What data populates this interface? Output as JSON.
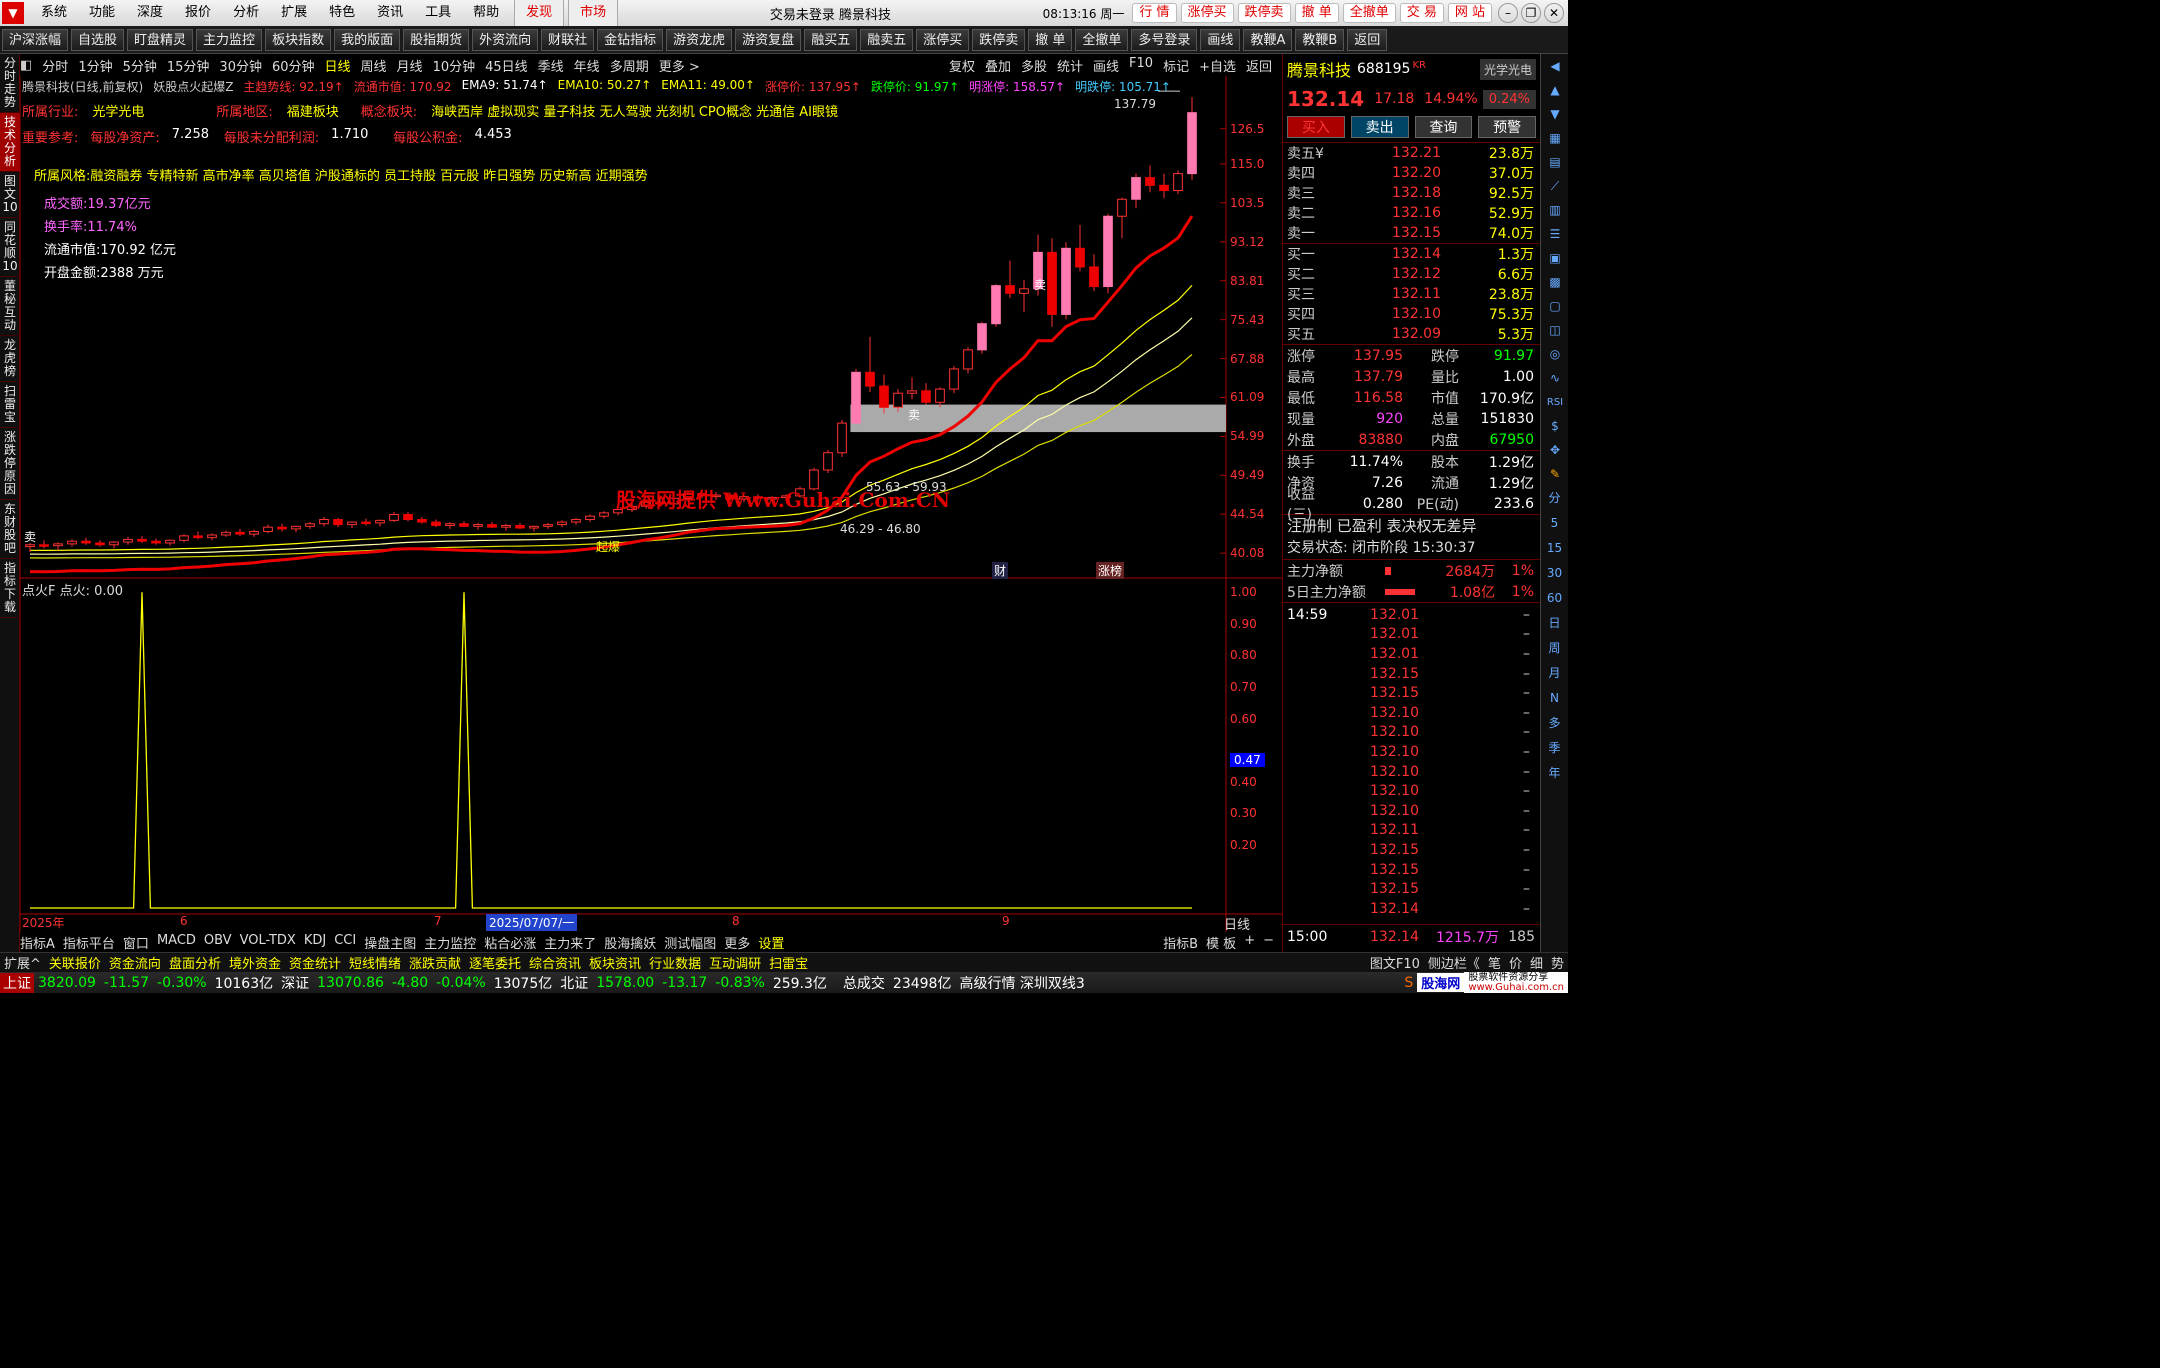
{
  "menu": {
    "items": [
      "系统",
      "功能",
      "深度",
      "报价",
      "分析",
      "扩展",
      "特色",
      "资讯",
      "工具",
      "帮助"
    ],
    "highlight": [
      "发现",
      "市场"
    ],
    "center_title": "交易未登录  腾景科技",
    "time": "08:13:16 周一",
    "right_buttons": [
      "行 情",
      "涨停买",
      "跌停卖",
      "撤 单",
      "全撤单",
      "交 易",
      "网 站"
    ]
  },
  "toolbar": [
    "沪深涨幅",
    "自选股",
    "盯盘精灵",
    "主力监控",
    "板块指数",
    "我的版面",
    "股指期货",
    "外资流向",
    "财联社",
    "金钻指标",
    "游资龙虎",
    "游资复盘",
    "融买五",
    "融卖五",
    "涨停买",
    "跌停卖",
    "撤 单",
    "全撤单",
    "多号登录",
    "画线",
    "教鞭A",
    "教鞭B",
    "返回"
  ],
  "left_tabs": [
    {
      "label": "分时走势",
      "active": false
    },
    {
      "label": "技术分析",
      "active": true
    },
    {
      "label": "图文10",
      "active": false
    },
    {
      "label": "同花顺10",
      "active": false
    },
    {
      "label": "董秘互动",
      "active": false
    },
    {
      "label": "龙虎榜",
      "active": false
    },
    {
      "label": "扫雷宝",
      "active": false
    },
    {
      "label": "涨跌停原因",
      "active": false
    },
    {
      "label": "东财股吧",
      "active": false
    },
    {
      "label": "指标下载",
      "active": false
    }
  ],
  "periods": [
    "分时",
    "1分钟",
    "5分钟",
    "15分钟",
    "30分钟",
    "60分钟",
    "日线",
    "周线",
    "月线",
    "10分钟",
    "45日线",
    "季线",
    "年线",
    "多周期",
    "更多 >"
  ],
  "period_active": "日线",
  "period_right": [
    "复权",
    "叠加",
    "多股",
    "统计",
    "画线",
    "F10",
    "标记",
    "+自选",
    "返回"
  ],
  "kinfo": {
    "name": "腾景科技(日线,前复权)",
    "formula": "妖股点火起爆Z",
    "main_line": "主趋势线: 92.19↑",
    "flow_mv": "流通市值: 170.92",
    "ema9": "EMA9: 51.74↑",
    "ema10": "EMA10: 50.27↑",
    "ema11": "EMA11: 49.00↑",
    "limit_up": "涨停价: 137.95↑",
    "limit_down": "跌停价: 91.97↑",
    "next_up": "明涨停: 158.57↑",
    "next_down": "明跌停: 105.71↑"
  },
  "industry": {
    "k1": "所属行业:",
    "v1": "光学光电",
    "k2": "所属地区:",
    "v2": "福建板块",
    "k3": "概念板块:",
    "v3": "海峡西岸 虚拟现实 量子科技 无人驾驶 光刻机 CPO概念 光通信 AI眼镜"
  },
  "important": {
    "k": "重要参考:",
    "a": "每股净资产:",
    "av": "7.258",
    "b": "每股未分配利润:",
    "bv": "1.710",
    "c": "每股公积金:",
    "cv": "4.453"
  },
  "style": "所属风格:融资融券 专精特新 高市净率 高贝塔值 沪股通标的 员工持股 百元股 昨日强势 历史新高 近期强势",
  "stats": [
    "成交额:19.37亿元",
    "换手率:11.74%",
    "流通市值:170.92 亿元",
    "开盘金额:2388 万元"
  ],
  "annotations": {
    "watermark": "股海网提供 Www.Guhai.Com.CN",
    "range1": "55.63 - 59.93",
    "range2": "46.29 - 46.80",
    "high_label": "137.79",
    "sell": "卖",
    "buy_label": "起爆",
    "cai": "财",
    "zhangbang": "涨榜"
  },
  "yaxis": [
    "126.5",
    "115.0",
    "103.5",
    "93.12",
    "83.81",
    "75.43",
    "67.88",
    "61.09",
    "54.99",
    "49.49",
    "44.54",
    "40.08"
  ],
  "ind_title": "点火F  点火: 0.00",
  "ind_yaxis": [
    "1.00",
    "0.90",
    "0.80",
    "0.70",
    "0.60",
    "0.47",
    "0.40",
    "0.30",
    "0.20"
  ],
  "date_axis": [
    "2025年",
    "6",
    "7",
    "2025/07/07/一",
    "8",
    "9"
  ],
  "date_axis_right": "日线",
  "bottom_tabs": [
    "指标A",
    "指标平台",
    "窗口",
    "MACD",
    "OBV",
    "VOL-TDX",
    "KDJ",
    "CCI",
    "操盘主图",
    "主力监控",
    "粘合必涨",
    "主力来了",
    "股海擒妖",
    "测试幅图",
    "更多",
    "设置"
  ],
  "bottom_right": [
    "指标B",
    "模 板",
    "+",
    "−"
  ],
  "infobar": [
    "扩展^",
    "关联报价",
    "资金流向",
    "盘面分析",
    "境外资金",
    "资金统计",
    "短线情绪",
    "涨跌贡献",
    "逐笔委托",
    "综合资讯",
    "板块资讯",
    "行业数据",
    "互动调研",
    "扫雷宝"
  ],
  "infobar_right": [
    "图文F10",
    "侧边栏《",
    "笔",
    "价",
    "细",
    "势"
  ],
  "status": {
    "sh_label": "上证",
    "sh": "3820.09",
    "sh_chg": "-11.57",
    "sh_pct": "-0.30%",
    "sh_amt": "10163亿",
    "sz_label": "深证",
    "sz": "13070.86",
    "sz_chg": "-4.80",
    "sz_pct": "-0.04%",
    "sz_amt": "13075亿",
    "bj_label": "北证",
    "bj": "1578.00",
    "bj_chg": "-13.17",
    "bj_pct": "-0.83%",
    "bj_amt": "259.3亿",
    "total_label": "总成交",
    "total": "23498亿",
    "market": "高级行情 深圳双线3",
    "brand": "股海网",
    "brand2": "股票软件资源分享",
    "url": "www.Guhai.com.cn"
  },
  "quote": {
    "name": "腾景科技",
    "code": "688195",
    "kr": "KR",
    "sector": "光学光电",
    "price": "132.14",
    "chg": "17.18",
    "pct": "14.94%",
    "amp": "0.24%",
    "buttons": [
      "买入",
      "卖出",
      "查询",
      "预警"
    ],
    "asks": [
      [
        "卖五¥",
        "132.21",
        "23.8万"
      ],
      [
        "卖四",
        "132.20",
        "37.0万"
      ],
      [
        "卖三",
        "132.18",
        "92.5万"
      ],
      [
        "卖二",
        "132.16",
        "52.9万"
      ],
      [
        "卖一",
        "132.15",
        "74.0万"
      ]
    ],
    "bids": [
      [
        "买一",
        "132.14",
        "1.3万"
      ],
      [
        "买二",
        "132.12",
        "6.6万"
      ],
      [
        "买三",
        "132.11",
        "23.8万"
      ],
      [
        "买四",
        "132.10",
        "75.3万"
      ],
      [
        "买五",
        "132.09",
        "5.3万"
      ]
    ],
    "stats1": [
      [
        "涨停",
        "137.95",
        "跌停",
        "91.97"
      ],
      [
        "最高",
        "137.79",
        "量比",
        "1.00"
      ],
      [
        "最低",
        "116.58",
        "市值",
        "170.9亿"
      ],
      [
        "现量",
        "920",
        "总量",
        "151830"
      ],
      [
        "外盘",
        "83880",
        "内盘",
        "67950"
      ]
    ],
    "stats2": [
      [
        "换手",
        "11.74%",
        "股本",
        "1.29亿"
      ],
      [
        "净资",
        "7.26",
        "流通",
        "1.29亿"
      ],
      [
        "收益(三)",
        "0.280",
        "PE(动)",
        "233.6"
      ]
    ],
    "reg": "注册制 已盈利 表决权无差异",
    "trade_state": "交易状态: 闭市阶段 15:30:37",
    "mainflow": [
      "主力净额",
      "2684万",
      "1%"
    ],
    "mainflow5": [
      "5日主力净额",
      "1.08亿",
      "1%"
    ],
    "ticks_time": "14:59",
    "ticks": [
      "132.01",
      "132.01",
      "132.01",
      "132.15",
      "132.15",
      "132.10",
      "132.10",
      "132.10",
      "132.10",
      "132.10",
      "132.10",
      "132.11",
      "132.15",
      "132.15",
      "132.15",
      "132.14"
    ],
    "tick_last_time": "15:00",
    "tick_last_price": "132.14",
    "tick_last_amt": "1215.7万",
    "tick_last_n": "185"
  },
  "right_strip": [
    "分",
    "5",
    "15",
    "30",
    "60",
    "日",
    "周",
    "月",
    "N",
    "多",
    "季",
    "年"
  ],
  "chart_data": {
    "type": "candlestick",
    "candles": [
      [
        40.8,
        41.2,
        40.2,
        41.0
      ],
      [
        41.0,
        41.5,
        40.6,
        40.9
      ],
      [
        40.9,
        41.3,
        40.4,
        41.1
      ],
      [
        41.1,
        41.6,
        40.8,
        41.4
      ],
      [
        41.4,
        41.8,
        41.0,
        41.2
      ],
      [
        41.2,
        41.5,
        40.8,
        41.0
      ],
      [
        41.0,
        41.4,
        40.6,
        41.3
      ],
      [
        41.3,
        41.9,
        41.0,
        41.6
      ],
      [
        41.6,
        42.0,
        41.2,
        41.4
      ],
      [
        41.4,
        41.7,
        41.0,
        41.2
      ],
      [
        41.2,
        41.6,
        40.9,
        41.5
      ],
      [
        41.5,
        42.2,
        41.3,
        42.0
      ],
      [
        42.0,
        42.5,
        41.6,
        41.8
      ],
      [
        41.8,
        42.3,
        41.5,
        42.1
      ],
      [
        42.1,
        42.6,
        41.9,
        42.4
      ],
      [
        42.4,
        42.8,
        42.0,
        42.2
      ],
      [
        42.2,
        42.7,
        41.9,
        42.5
      ],
      [
        42.5,
        43.3,
        42.3,
        43.0
      ],
      [
        43.0,
        43.4,
        42.5,
        42.8
      ],
      [
        42.8,
        43.2,
        42.4,
        43.1
      ],
      [
        43.1,
        43.6,
        42.8,
        43.4
      ],
      [
        43.4,
        44.2,
        43.1,
        43.9
      ],
      [
        43.9,
        44.1,
        43.0,
        43.3
      ],
      [
        43.3,
        43.7,
        42.9,
        43.6
      ],
      [
        43.6,
        44.0,
        43.2,
        43.5
      ],
      [
        43.5,
        43.9,
        43.1,
        43.8
      ],
      [
        43.8,
        44.8,
        43.6,
        44.5
      ],
      [
        44.5,
        44.8,
        43.7,
        43.9
      ],
      [
        43.9,
        44.2,
        43.4,
        43.6
      ],
      [
        43.6,
        43.9,
        43.0,
        43.2
      ],
      [
        43.2,
        43.6,
        42.8,
        43.4
      ],
      [
        43.4,
        43.7,
        43.0,
        43.1
      ],
      [
        43.1,
        43.5,
        42.7,
        43.3
      ],
      [
        43.3,
        43.6,
        42.9,
        43.0
      ],
      [
        43.0,
        43.4,
        42.6,
        43.2
      ],
      [
        43.2,
        43.5,
        42.8,
        42.9
      ],
      [
        42.9,
        43.2,
        42.5,
        43.1
      ],
      [
        43.1,
        43.5,
        42.8,
        43.3
      ],
      [
        43.3,
        43.8,
        43.0,
        43.6
      ],
      [
        43.6,
        44.1,
        43.3,
        43.9
      ],
      [
        43.9,
        44.5,
        43.6,
        44.3
      ],
      [
        44.3,
        44.9,
        44.0,
        44.7
      ],
      [
        44.7,
        45.4,
        44.4,
        45.1
      ],
      [
        45.1,
        45.8,
        44.8,
        45.5
      ],
      [
        45.5,
        46.3,
        45.2,
        46.0
      ],
      [
        46.0,
        46.6,
        45.6,
        45.8
      ],
      [
        45.8,
        46.8,
        45.5,
        46.5
      ],
      [
        46.5,
        47.4,
        46.2,
        47.1
      ],
      [
        47.1,
        47.6,
        46.5,
        46.8
      ],
      [
        46.8,
        47.3,
        46.3,
        46.9
      ],
      [
        46.9,
        47.2,
        46.1,
        46.4
      ],
      [
        46.4,
        46.9,
        46.0,
        46.7
      ],
      [
        46.7,
        47.0,
        46.2,
        46.5
      ],
      [
        46.5,
        46.8,
        46.0,
        46.6
      ],
      [
        46.6,
        47.0,
        46.2,
        46.8
      ],
      [
        46.8,
        48.0,
        46.6,
        47.7
      ],
      [
        47.7,
        50.5,
        47.5,
        50.2
      ],
      [
        50.2,
        53.0,
        49.8,
        52.6
      ],
      [
        52.6,
        57.5,
        52.0,
        57.0
      ],
      [
        57.0,
        66.0,
        56.8,
        65.4
      ],
      [
        65.4,
        72.0,
        62.0,
        63.0
      ],
      [
        63.0,
        65.0,
        58.5,
        59.5
      ],
      [
        59.5,
        62.5,
        58.8,
        61.8
      ],
      [
        61.8,
        64.5,
        60.8,
        62.2
      ],
      [
        62.2,
        63.5,
        59.9,
        60.3
      ],
      [
        60.3,
        62.8,
        59.5,
        62.5
      ],
      [
        62.5,
        66.5,
        61.8,
        66.0
      ],
      [
        66.0,
        70.0,
        65.2,
        69.5
      ],
      [
        69.5,
        75.0,
        68.8,
        74.6
      ],
      [
        74.6,
        83.0,
        74.0,
        82.7
      ],
      [
        82.7,
        88.5,
        80.0,
        81.0
      ],
      [
        81.0,
        84.0,
        77.0,
        82.0
      ],
      [
        82.0,
        95.0,
        80.5,
        90.5
      ],
      [
        90.5,
        94.0,
        74.0,
        76.5
      ],
      [
        76.5,
        93.0,
        75.5,
        91.5
      ],
      [
        91.5,
        97.5,
        86.0,
        87.0
      ],
      [
        87.0,
        90.0,
        81.5,
        82.5
      ],
      [
        82.5,
        100.5,
        81.0,
        99.8
      ],
      [
        99.8,
        105.0,
        94.0,
        104.5
      ],
      [
        104.5,
        112.0,
        102.0,
        110.8
      ],
      [
        110.8,
        114.5,
        106.5,
        108.5
      ],
      [
        108.5,
        112.0,
        104.8,
        107.0
      ],
      [
        107.0,
        113.0,
        106.0,
        112.0
      ],
      [
        112.0,
        137.8,
        110.0,
        132.1
      ]
    ]
  }
}
